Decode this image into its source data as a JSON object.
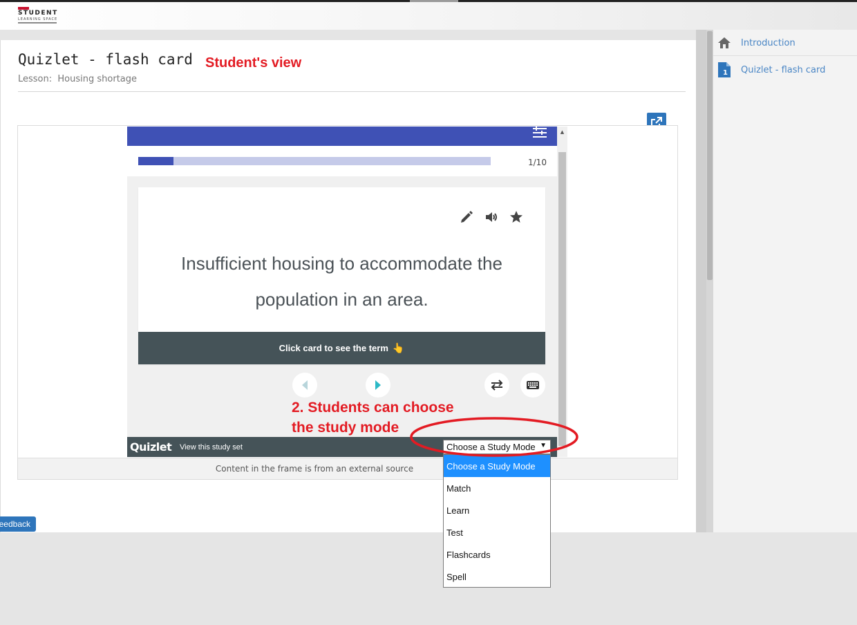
{
  "header": {
    "logo_top": "",
    "logo_title": "STUDENT",
    "logo_subtitle": "LEARNING SPACE"
  },
  "page": {
    "title": "Quizlet - flash card",
    "lesson_label": "Lesson:",
    "lesson_name": "Housing shortage",
    "annotation_view": "Student's view"
  },
  "frame": {
    "footer_text": "Content in the frame is from an external source"
  },
  "quizlet": {
    "progress": {
      "current": 1,
      "total": 10,
      "fraction": 0.1
    },
    "counter": "1/10",
    "card_text": "Insufficient housing to accommodate the population in an area.",
    "card_footer": "Click card to see the term",
    "card_footer_emoji": "👆",
    "brand": "Quizlet",
    "view_set_link": "View this study set",
    "annotation_line1": "2. Students can choose",
    "annotation_line2": "the study mode",
    "icons": {
      "edit": "pencil-icon",
      "audio": "speaker-icon",
      "star": "star-icon",
      "prev": "triangle-left-icon",
      "next": "triangle-right-icon",
      "shuffle": "swap-arrows-icon",
      "keyboard": "keyboard-icon",
      "options": "sliders-icon"
    }
  },
  "study_mode": {
    "selected": "Choose a Study Mode",
    "caret": "▼",
    "options": [
      "Choose a Study Mode",
      "Match",
      "Learn",
      "Test",
      "Flashcards",
      "Spell"
    ]
  },
  "sidebar": {
    "items": [
      {
        "label": "Introduction",
        "icon": "home-icon"
      },
      {
        "label": "Quizlet - flash card",
        "icon": "document-icon",
        "badge": "1"
      }
    ]
  },
  "feedback": {
    "label": "Feedback"
  },
  "colors": {
    "accent": "#3f51b5",
    "annotation": "#e31b23",
    "link": "#4a86c5",
    "dropdown_highlight": "#1e90ff",
    "bar_dark": "#455358"
  }
}
